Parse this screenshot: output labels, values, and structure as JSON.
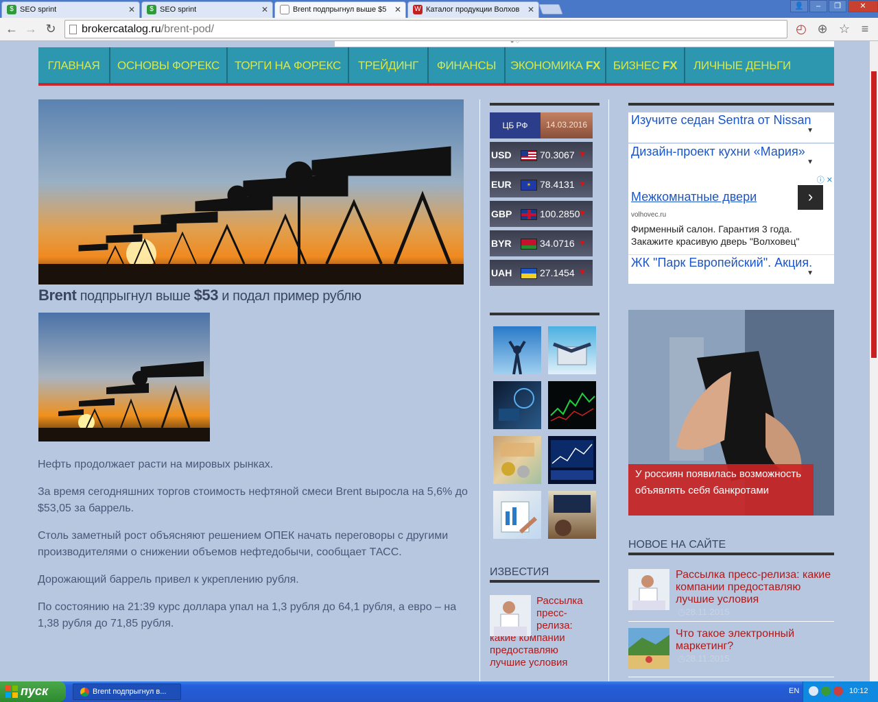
{
  "browser": {
    "tabs": [
      {
        "label": "SEO sprint",
        "icon": "seosprint-favicon",
        "active": false
      },
      {
        "label": "SEO sprint",
        "icon": "seosprint-favicon",
        "active": false
      },
      {
        "label": "Brent подпрыгнул выше $5",
        "icon": "page-icon",
        "active": true
      },
      {
        "label": "Каталог продукции Волхов",
        "icon": "volhovec-favicon",
        "active": false
      }
    ],
    "url_domain": "brokercatalog.ru",
    "url_path": "/brent-pod/"
  },
  "nav": {
    "items": [
      {
        "label": "ГЛАВНАЯ",
        "fx": ""
      },
      {
        "label": "ОСНОВЫ ФОРЕКС",
        "fx": ""
      },
      {
        "label": "ТОРГИ НА ФОРЕКС",
        "fx": ""
      },
      {
        "label": "ТРЕЙДИНГ",
        "fx": ""
      },
      {
        "label": "ФИНАНСЫ",
        "fx": ""
      },
      {
        "label": "ЭКОНОМИКА",
        "fx": "FX"
      },
      {
        "label": "БИЗНЕС",
        "fx": "FX"
      },
      {
        "label": "ЛИЧНЫЕ ДЕНЬГИ",
        "fx": ""
      }
    ]
  },
  "article": {
    "title_part1": "Brent",
    "title_part2": " подпрыгнул выше ",
    "title_part3": "$53",
    "title_part4": " и подал пример рублю",
    "paragraphs": [
      "Нефть продолжает расти на мировых рынках.",
      "За время сегодняшних торгов стоимость нефтяной смеси Brent выросла на 5,6% до $53,05 за баррель.",
      "Столь заметный рост объясняют решением ОПЕК начать переговоры с другими производителями о снижении объемов нефтедобычи, сообщает ТАСС.",
      "Дорожающий баррель привел к укреплению рубля.",
      "По состоянию на 21:39 курс доллара упал на 1,3 рубля до 64,1 рубля, а евро – на 1,38 рубля до 71,85 рубля."
    ]
  },
  "currency": {
    "source": "ЦБ РФ",
    "date": "14.03.2016",
    "rates": [
      {
        "code": "USD",
        "rate": "70.3067",
        "flag": "us-flag-icon"
      },
      {
        "code": "EUR",
        "rate": "78.4131",
        "flag": "eu-flag-icon"
      },
      {
        "code": "GBP",
        "rate": "100.2850",
        "flag": "uk-flag-icon"
      },
      {
        "code": "BYR",
        "rate": "34.0716",
        "flag": "by-flag-icon"
      },
      {
        "code": "UAH",
        "rate": "27.1454",
        "flag": "ua-flag-icon"
      }
    ],
    "down_arrow": "▼"
  },
  "ads": {
    "sentra": "Изучите седан Sentra от Nissan",
    "kitchen": "Дизайн-проект кухни «Мария»",
    "doors_title": "Межкомнатные двери",
    "doors_domain": "volhovec.ru",
    "doors_desc": "Фирменный салон. Гарантия 3 года. Закажите красивую дверь \"Волховец\"",
    "park": "ЖК \"Парк Европейский\". Акция."
  },
  "promo": {
    "caption": "У россиян появилась возможность объявлять себя банкротами"
  },
  "izvestia": {
    "title": "ИЗВЕСТИЯ",
    "item": "Рассылка пресс-релиза: какие компании предоставляю лучшие условия"
  },
  "new_on_site": {
    "title": "НОВОЕ НА САЙТЕ",
    "items": [
      {
        "title": "Рассылка пресс-релиза: какие компании предоставляю лучшие условия",
        "date": "28.11.2015"
      },
      {
        "title": "Что такое электронный маркетинг?",
        "date": "28.11.2015"
      }
    ]
  },
  "taskbar": {
    "start": "пуск",
    "task": "Brent подпрыгнул в...",
    "lang": "EN",
    "clock": "10:12"
  },
  "colors": {
    "page_bg": "#b7c7e0",
    "nav_bg": "#2c97ae",
    "nav_text": "#d8e84a",
    "accent_red": "#c8272e",
    "link_red": "#b01818"
  }
}
